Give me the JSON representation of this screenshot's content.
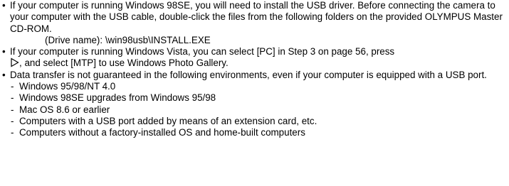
{
  "bullets": [
    {
      "mark": "•",
      "text": "If your computer is running Windows 98SE, you will need to install the USB driver. Before connecting the camera to your computer with the USB cable, double-click the files from the following folders on the provided OLYMPUS Master CD-ROM.",
      "path": "(Drive name): \\win98usb\\INSTALL.EXE"
    },
    {
      "mark": "•",
      "text_before_icon": "If your computer is running Windows Vista, you can select [PC] in Step 3 on page 56, press",
      "icon": "right-arrow-outline-icon",
      "text_after_icon": ", and select [MTP] to use Windows Photo Gallery."
    },
    {
      "mark": "•",
      "text": "Data transfer is not guaranteed in the following environments, even if your computer is equipped with a USB port.",
      "sub_items": [
        "Windows 95/98/NT 4.0",
        "Windows 98SE upgrades from Windows 95/98",
        "Mac OS 8.6 or earlier",
        "Computers with a USB port added by means of an extension card, etc.",
        "Computers without a factory-installed OS and home-built computers"
      ],
      "sub_mark": "-"
    }
  ]
}
